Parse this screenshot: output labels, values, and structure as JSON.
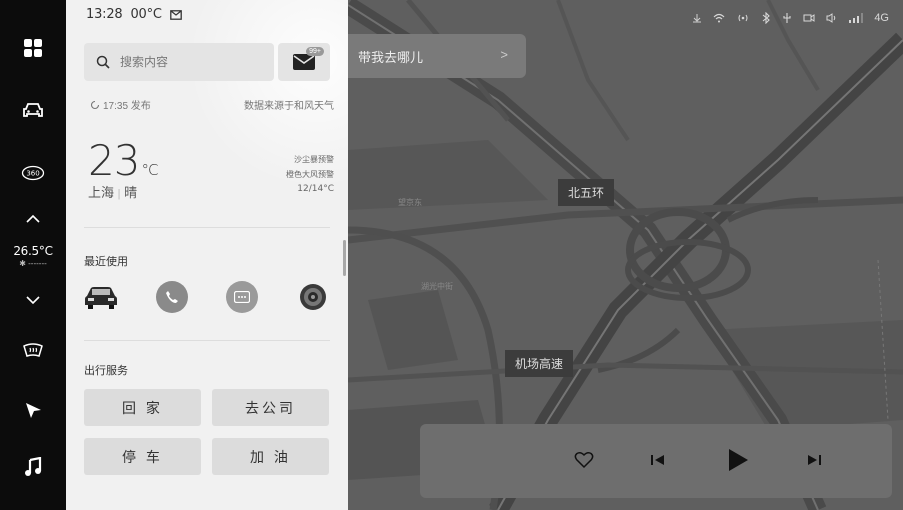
{
  "status": {
    "time": "13:28",
    "temperature": "00°C",
    "network": "4G"
  },
  "rail": {
    "temp": "26.5°C",
    "fan": "✱ -------",
    "items": [
      "apps-grid-icon",
      "car-icon",
      "camera-360-icon",
      "chevron-up-icon",
      "chevron-down-icon",
      "defrost-icon",
      "navigation-icon",
      "music-icon"
    ],
    "label_360": "360"
  },
  "search": {
    "placeholder": "搜索内容"
  },
  "mail": {
    "badge": "99+"
  },
  "weather": {
    "published": "17:35 发布",
    "source": "数据来源于和风天气",
    "temp": "23",
    "unit": "°C",
    "city": "上海",
    "condition": "晴",
    "alert1": "沙尘暴预警",
    "alert2": "橙色大风预警",
    "range": "12/14°C"
  },
  "recent": {
    "title": "最近使用",
    "apps": [
      "car-icon",
      "phone-icon",
      "message-icon",
      "settings-icon"
    ]
  },
  "services": {
    "title": "出行服务",
    "home": "回 家",
    "office": "去公司",
    "parking": "停 车",
    "fuel": "加 油"
  },
  "map": {
    "destination": "带我去哪儿",
    "chevron": ">",
    "road1": "北五环",
    "road2": "机场高速",
    "place1": "望京东",
    "place2": "湖光中街"
  }
}
